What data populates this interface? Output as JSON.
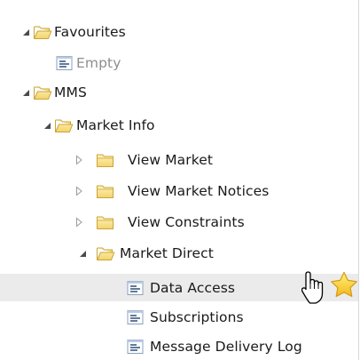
{
  "tree": {
    "favourites": {
      "label": "Favourites",
      "children": [
        {
          "label": "Empty"
        }
      ]
    },
    "mms": {
      "label": "MMS",
      "market_info": {
        "label": "Market Info",
        "children": [
          {
            "label": "View Market",
            "expanded": false
          },
          {
            "label": "View Market Notices",
            "expanded": false
          },
          {
            "label": "View Constraints",
            "expanded": false
          }
        ],
        "market_direct": {
          "label": "Market Direct",
          "expanded": true,
          "items": [
            {
              "label": "Data Access",
              "selected": true,
              "favourite": true
            },
            {
              "label": "Subscriptions"
            },
            {
              "label": "Message Delivery Log"
            }
          ]
        }
      }
    }
  },
  "icons": {
    "expanded": "expanded-arrow-icon",
    "collapsed": "collapsed-arrow-icon",
    "folder_open": "folder-open-icon",
    "folder_closed": "folder-closed-icon",
    "document": "document-icon",
    "favourite": "star-icon",
    "cursor": "hand-cursor-icon"
  },
  "colors": {
    "folder_fill": "#fbe79a",
    "folder_stroke": "#c9a437",
    "arrow": "#4a4a4a",
    "selected_row": "#ebebeb",
    "star": "#fbd341"
  }
}
